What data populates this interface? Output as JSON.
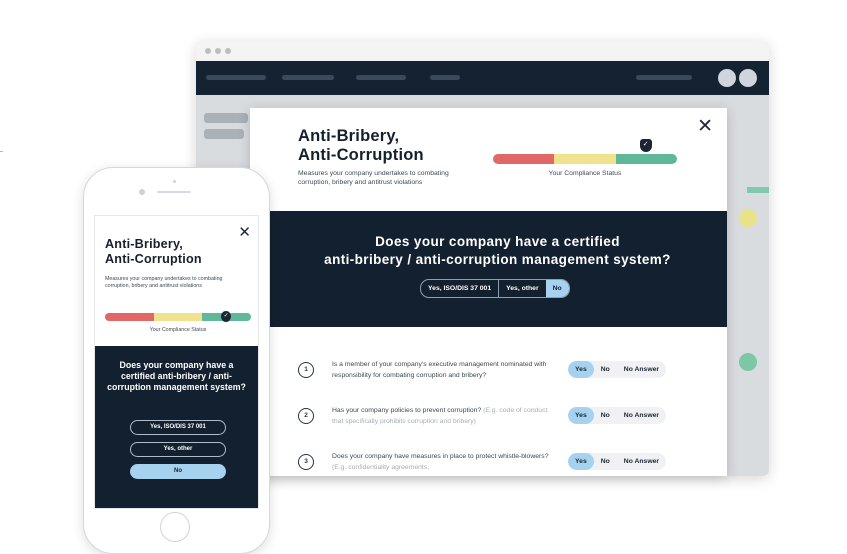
{
  "colors": {
    "navy": "#13202f",
    "accent_blue": "#a6d2ef",
    "bar_red": "#e26868",
    "bar_yellow": "#f1e38d",
    "bar_green": "#5fb89a"
  },
  "icons": {
    "close": "close-icon",
    "shield": "shield-check-icon"
  },
  "compliance": {
    "level_fraction": 0.83
  },
  "modal": {
    "close_glyph": "✕",
    "title_line1": "Anti-Bribery,",
    "title_line2": "Anti-Corruption",
    "description": "Measures your company undertakes to combating corruption, bribery and antitrust violations",
    "status_label": "Your Compliance Status",
    "question_line1": "Does your company have a certified",
    "question_line2": "anti-bribery / anti-corruption management system?",
    "options": [
      "Yes, ISO/DIS 37 001",
      "Yes, other",
      "No"
    ],
    "selected_option": "No",
    "sub_questions": [
      {
        "number": "1",
        "text": "Is a member of your company's executive management nominated with responsibility for combating corruption and bribery?",
        "hint": "",
        "answers": [
          "Yes",
          "No",
          "No Answer"
        ],
        "selected": "Yes"
      },
      {
        "number": "2",
        "text": "Has your company policies to prevent corruption?",
        "hint": "(E.g. code of conduct that specifically prohibits corruption and bribery)",
        "answers": [
          "Yes",
          "No",
          "No Answer"
        ],
        "selected": "Yes"
      },
      {
        "number": "3",
        "text": "Does your company have measures in place to protect whistle-blowers?",
        "hint": "(E.g. confidentiality agreements,",
        "answers": [
          "Yes",
          "No",
          "No Answer"
        ],
        "selected": "Yes"
      }
    ]
  },
  "phone": {
    "close_glyph": "✕",
    "title_line1": "Anti-Bribery,",
    "title_line2": "Anti-Corruption",
    "description": "Measures your company undertakes to combating corruption, bribery and antitrust violations",
    "status_label": "Your Compliance Status",
    "question": "Does your company have a certified anti-bribery / anti-corruption management system?",
    "options": [
      "Yes, ISO/DIS 37 001",
      "Yes, other",
      "No"
    ],
    "selected_option": "No"
  }
}
